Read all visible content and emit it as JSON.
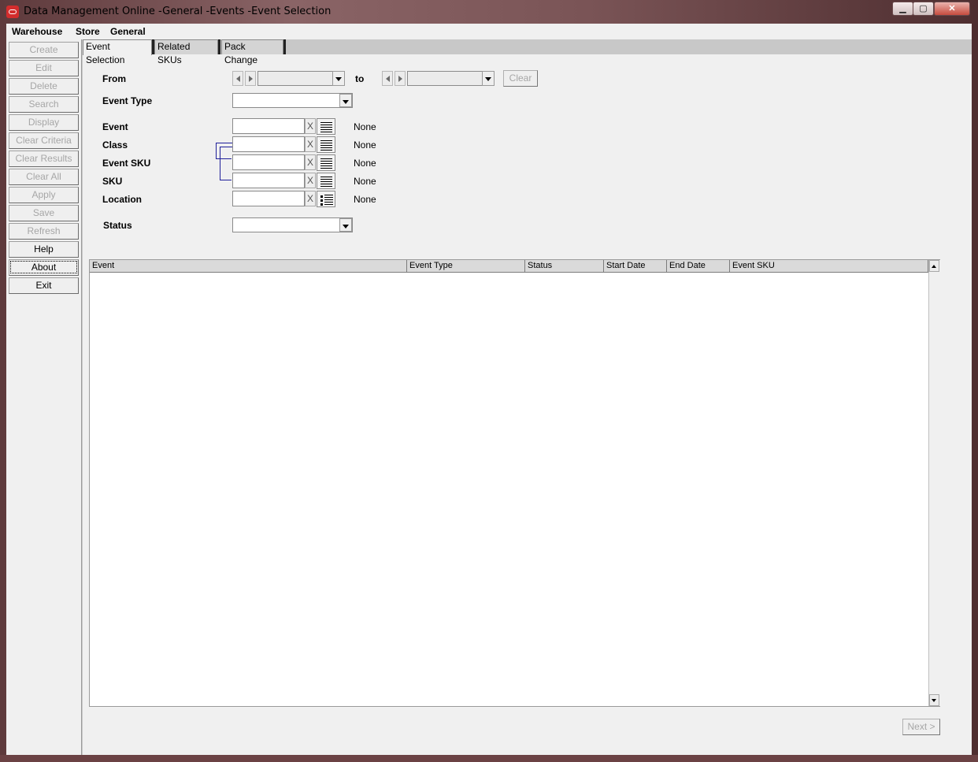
{
  "window": {
    "title": "Data Management Online -General -Events -Event Selection",
    "min_glyph": "▁",
    "max_glyph": "▢",
    "close_glyph": "✕"
  },
  "menu": [
    "Warehouse",
    "Store",
    "General"
  ],
  "sidebar": {
    "buttons": [
      {
        "label": "Create",
        "enabled": false
      },
      {
        "label": "Edit",
        "enabled": false
      },
      {
        "label": "Delete",
        "enabled": false
      },
      {
        "label": "Search",
        "enabled": false
      },
      {
        "label": "Display",
        "enabled": false
      },
      {
        "label": "Clear Criteria",
        "enabled": false
      },
      {
        "label": "Clear Results",
        "enabled": false
      },
      {
        "label": "Clear All",
        "enabled": false
      },
      {
        "label": "Apply",
        "enabled": false
      },
      {
        "label": "Save",
        "enabled": false
      },
      {
        "label": "Refresh",
        "enabled": false
      },
      {
        "label": "Help",
        "enabled": true
      },
      {
        "label": "About",
        "enabled": true
      },
      {
        "label": "Exit",
        "enabled": true
      }
    ]
  },
  "tabs": [
    "Event Selection",
    "Related SKUs",
    "Pack Change"
  ],
  "form": {
    "from_label": "From",
    "to_label": "to",
    "clear_label": "Clear",
    "event_type_label": "Event Type",
    "fields": [
      {
        "label": "Event",
        "value": "",
        "desc": "None"
      },
      {
        "label": "Class",
        "value": "",
        "desc": "None"
      },
      {
        "label": "Event SKU",
        "value": "",
        "desc": "None"
      },
      {
        "label": "SKU",
        "value": "",
        "desc": "None"
      },
      {
        "label": "Location",
        "value": "",
        "desc": "None"
      }
    ],
    "x_glyph": "X",
    "status_label": "Status"
  },
  "table": {
    "columns": [
      "Event",
      "Event Type",
      "Status",
      "Start Date",
      "End Date",
      "Event SKU"
    ],
    "rows": []
  },
  "footer": {
    "next_label": "Next >"
  }
}
